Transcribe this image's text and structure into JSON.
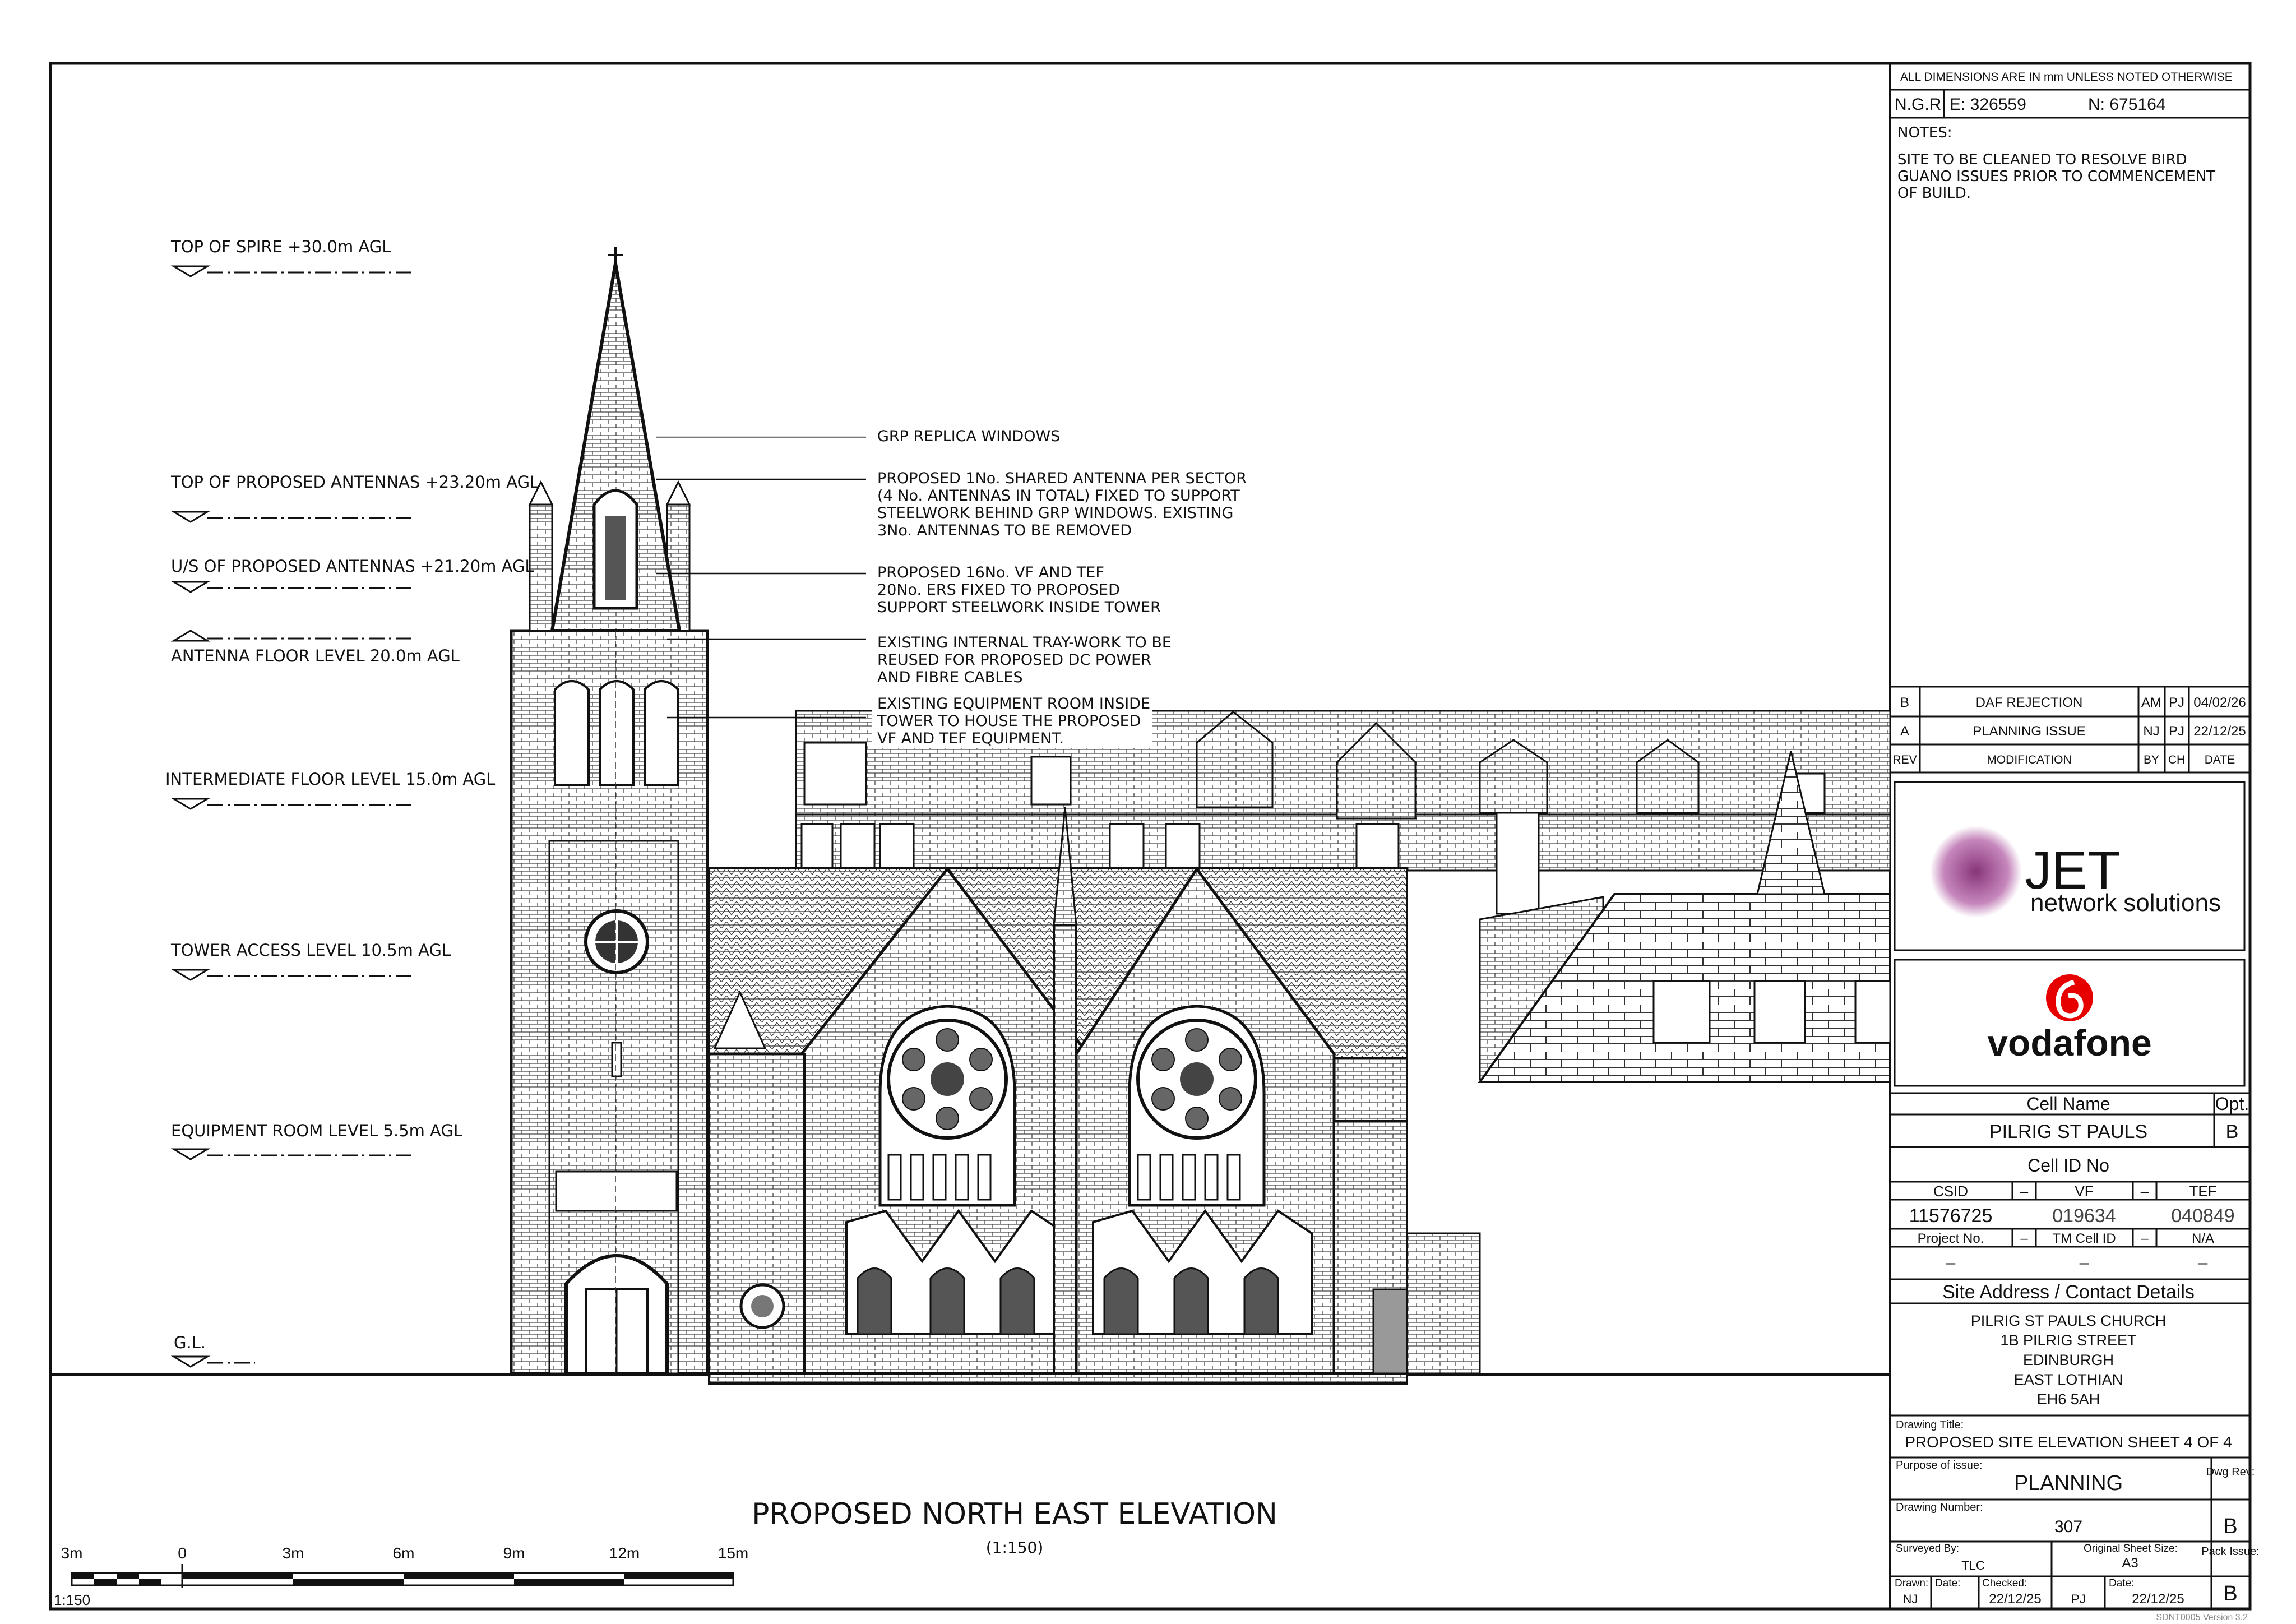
{
  "header": {
    "dims_note": "ALL DIMENSIONS ARE IN mm UNLESS NOTED OTHERWISE",
    "ngr_label": "N.G.R",
    "easting": "E: 326559",
    "northing": "N:  675164"
  },
  "notes": {
    "title": "NOTES:",
    "lines": [
      "SITE TO BE CLEANED TO RESOLVE BIRD",
      "GUANO ISSUES PRIOR TO COMMENCEMENT",
      "OF BUILD."
    ]
  },
  "revisions": {
    "rows": [
      {
        "rev": "B",
        "mod": "DAF REJECTION",
        "by": "AM",
        "ch": "PJ",
        "date": "04/02/26"
      },
      {
        "rev": "A",
        "mod": "PLANNING ISSUE",
        "by": "NJ",
        "ch": "PJ",
        "date": "22/12/25"
      }
    ],
    "header": {
      "rev": "REV",
      "mod": "MODIFICATION",
      "by": "BY",
      "ch": "CH",
      "date": "DATE"
    }
  },
  "logos": {
    "jet_word": "JET",
    "jet_sub": "network solutions",
    "vodafone": "vodafone"
  },
  "cell": {
    "name_label": "Cell Name",
    "opt_label": "Opt.",
    "name": "PILRIG ST PAULS",
    "opt": "B",
    "id_label": "Cell ID No",
    "csid_label": "CSID",
    "vf_label": "VF",
    "tef_label": "TEF",
    "dash": "–",
    "csid": "11576725",
    "vf": "019634",
    "tef": "040849",
    "project_label": "Project No.",
    "tm_label": "TM Cell ID",
    "na": "N/A"
  },
  "site": {
    "label": "Site Address / Contact Details",
    "lines": [
      "PILRIG ST PAULS CHURCH",
      "1B PILRIG STREET",
      "EDINBURGH",
      "EAST LOTHIAN",
      "EH6 5AH"
    ]
  },
  "drawing": {
    "title_label": "Drawing Title:",
    "title": "PROPOSED SITE ELEVATION SHEET 4 OF 4",
    "purpose_label": "Purpose of issue:",
    "purpose": "PLANNING",
    "dwg_rev_label": "Dwg Rev:",
    "number_label": "Drawing Number:",
    "number": "307",
    "dwg_rev": "B",
    "surveyed_label": "Surveyed By:",
    "surveyed": "TLC",
    "sheet_label": "Original Sheet Size:",
    "sheet": "A3",
    "pack_label": "Pack Issue:",
    "drawn_label": "Drawn:",
    "drawn": "NJ",
    "date_label": "Date:",
    "drawn_date": "22/12/25",
    "checked_label": "Checked:",
    "checked": "PJ",
    "checked_date": "22/12/25",
    "pack": "B",
    "version": "SDNT0005 Version 3.2"
  },
  "levels": [
    "TOP OF SPIRE +30.0m AGL",
    "TOP OF PROPOSED ANTENNAS +23.20m AGL",
    "U/S OF PROPOSED ANTENNAS +21.20m AGL",
    "ANTENNA FLOOR LEVEL 20.0m AGL",
    "INTERMEDIATE FLOOR LEVEL 15.0m AGL",
    "TOWER ACCESS LEVEL 10.5m AGL",
    "EQUIPMENT ROOM LEVEL 5.5m AGL",
    "G.L."
  ],
  "callouts": {
    "grp": "GRP REPLICA WINDOWS",
    "antennas": [
      "PROPOSED 1No. SHARED ANTENNA PER SECTOR",
      "(4 No. ANTENNAS IN TOTAL) FIXED TO SUPPORT",
      "STEELWORK BEHIND GRP WINDOWS. EXISTING",
      "3No. ANTENNAS TO BE REMOVED"
    ],
    "ers": [
      "PROPOSED 16No. VF AND TEF",
      "20No. ERS FIXED TO PROPOSED",
      "SUPPORT STEELWORK INSIDE TOWER"
    ],
    "tray": [
      "EXISTING INTERNAL TRAY-WORK TO BE",
      "REUSED FOR PROPOSED DC POWER",
      "AND FIBRE CABLES"
    ],
    "equip": [
      "EXISTING EQUIPMENT ROOM INSIDE",
      "TOWER TO HOUSE THE PROPOSED",
      "VF AND TEF EQUIPMENT."
    ]
  },
  "elevation": {
    "title": "PROPOSED NORTH EAST ELEVATION",
    "scale": "(1:150)"
  },
  "scalebar": {
    "labels": [
      "3m",
      "0",
      "3m",
      "6m",
      "9m",
      "12m",
      "15m"
    ],
    "ratio": "1:150"
  }
}
